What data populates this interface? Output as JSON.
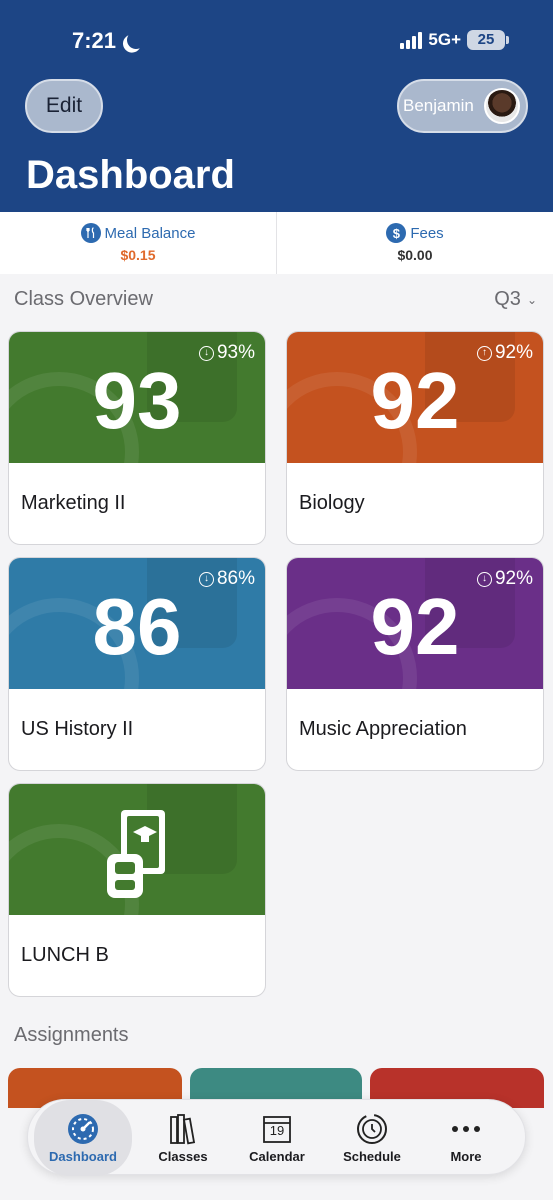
{
  "status": {
    "time": "7:21",
    "network": "5G+",
    "battery": "25"
  },
  "header": {
    "edit_label": "Edit",
    "user_name": "Benjamin",
    "title": "Dashboard"
  },
  "balances": [
    {
      "label": "Meal Balance",
      "value": "$0.15",
      "icon": "fork-knife-icon"
    },
    {
      "label": "Fees",
      "value": "$0.00",
      "icon": "dollar-icon"
    }
  ],
  "class_overview": {
    "title": "Class Overview",
    "quarter": "Q3",
    "classes": [
      {
        "name": "Marketing II",
        "grade": "93",
        "percent": "93%",
        "trend": "down",
        "color": "#437a2e"
      },
      {
        "name": "Biology",
        "grade": "92",
        "percent": "92%",
        "trend": "up",
        "color": "#c4521f"
      },
      {
        "name": "US History II",
        "grade": "86",
        "percent": "86%",
        "trend": "down",
        "color": "#2f7ba7"
      },
      {
        "name": "Music Appreciation",
        "grade": "92",
        "percent": "92%",
        "trend": "down",
        "color": "#6a2f88"
      },
      {
        "name": "LUNCH B",
        "grade": "",
        "percent": "",
        "trend": "",
        "color": "#437a2e"
      }
    ]
  },
  "assignments": {
    "title": "Assignments"
  },
  "tabs": [
    {
      "label": "Dashboard",
      "icon": "gauge-icon",
      "active": true
    },
    {
      "label": "Classes",
      "icon": "books-icon"
    },
    {
      "label": "Calendar",
      "icon": "calendar-icon",
      "day": "19"
    },
    {
      "label": "Schedule",
      "icon": "clock-icon"
    },
    {
      "label": "More",
      "icon": "more-dots-icon"
    }
  ]
}
